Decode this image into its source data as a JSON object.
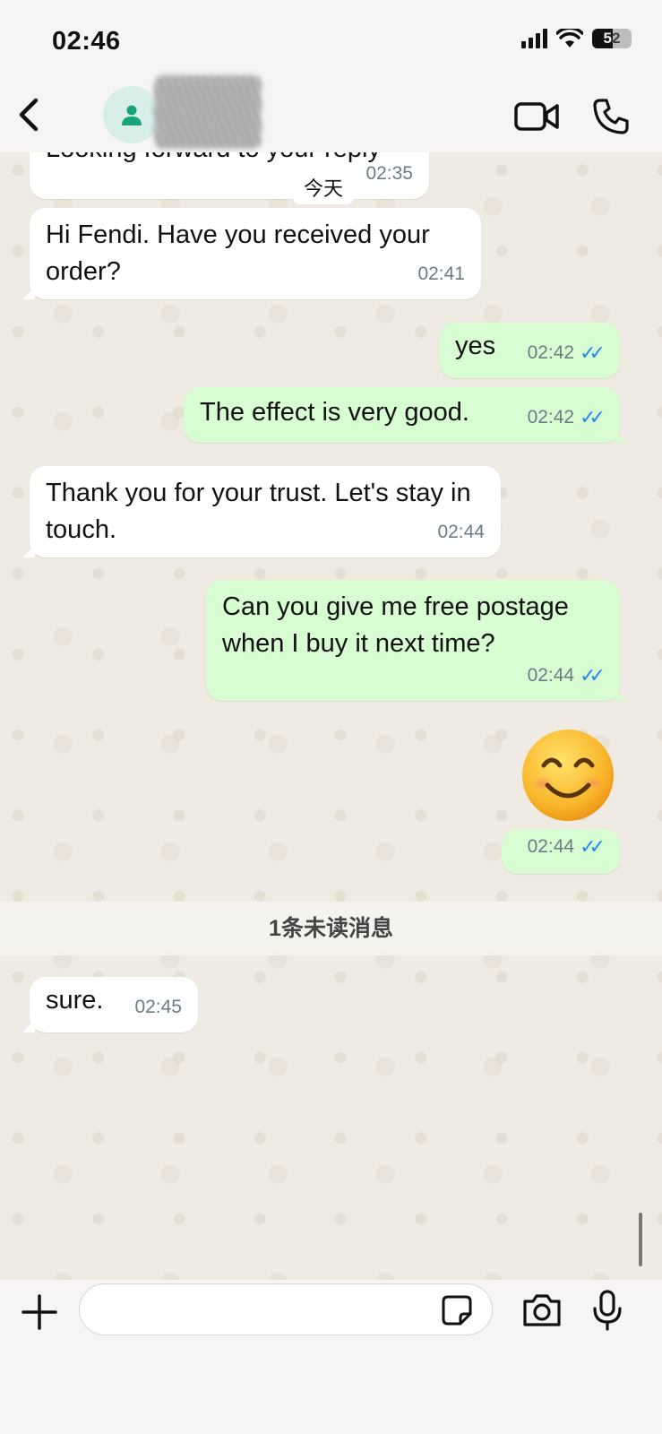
{
  "status_bar": {
    "time": "02:46",
    "battery_level": "52",
    "battery_fraction": 0.52,
    "icons": [
      "signal-icon",
      "wifi-icon",
      "battery-icon"
    ]
  },
  "header": {
    "contact_name": "",
    "icons": [
      "back-icon",
      "avatar-icon",
      "video-call-icon",
      "phone-icon"
    ]
  },
  "chat": {
    "partial_message": {
      "text": "Looking forward to your reply",
      "time": "02:35"
    },
    "date_chip": "今天",
    "messages": [
      {
        "direction": "in",
        "text": "Hi Fendi. Have you received your order?",
        "time": "02:41"
      },
      {
        "direction": "out",
        "text": "yes",
        "time": "02:42",
        "status": "read"
      },
      {
        "direction": "out",
        "text": "The effect is very good.",
        "time": "02:42",
        "status": "read"
      },
      {
        "direction": "in",
        "text": "Thank you for your trust. Let's stay in touch.",
        "time": "02:44"
      },
      {
        "direction": "out",
        "text": "Can you give me free postage when I buy it next time?",
        "time": "02:44",
        "status": "read"
      },
      {
        "direction": "out",
        "text": "😊",
        "time": "02:44",
        "status": "read"
      },
      {
        "direction": "in",
        "text": "sure.",
        "time": "02:45"
      }
    ],
    "unread_banner": "1条未读消息"
  },
  "input_bar": {
    "placeholder": "",
    "icons": [
      "plus-icon",
      "sticker-icon",
      "camera-icon",
      "mic-icon"
    ]
  },
  "colors": {
    "incoming_bubble": "#ffffff",
    "outgoing_bubble": "#d9fdd3",
    "read_ticks": "#1f8bed",
    "accent": "#1aa37a"
  }
}
